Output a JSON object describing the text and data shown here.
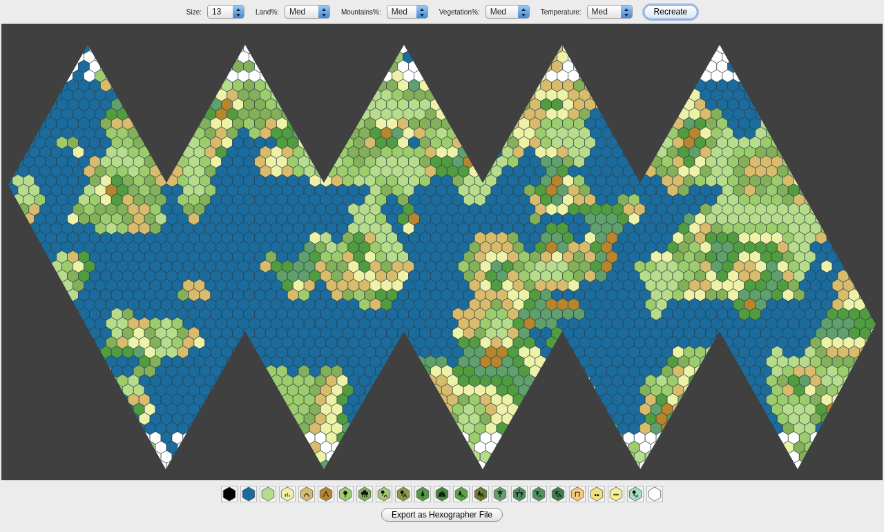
{
  "toolbar": {
    "fields": [
      {
        "label": "Size:",
        "value": "13"
      },
      {
        "label": "Land%:",
        "value": "Med"
      },
      {
        "label": "Mountains%:",
        "value": "Med"
      },
      {
        "label": "Vegetation%:",
        "value": "Med"
      },
      {
        "label": "Temperature:",
        "value": "Med"
      }
    ],
    "button": "Recreate"
  },
  "palette": [
    {
      "kind": "plain",
      "color": "#000000"
    },
    {
      "kind": "plain",
      "color": "#1b6c9c"
    },
    {
      "kind": "plain",
      "color": "#b6dc8c"
    },
    {
      "kind": "grass",
      "color": "#eef2a6"
    },
    {
      "kind": "hills",
      "color": "#d8bc6c"
    },
    {
      "kind": "mountain",
      "color": "#b6852c"
    },
    {
      "kind": "tree",
      "color": "#9ccc6c"
    },
    {
      "kind": "trees",
      "color": "#84b05a"
    },
    {
      "kind": "tree-hills",
      "color": "#a4c87a"
    },
    {
      "kind": "tree-mountain",
      "color": "#8e9848"
    },
    {
      "kind": "pine",
      "color": "#529c40"
    },
    {
      "kind": "pines",
      "color": "#428a3a"
    },
    {
      "kind": "pine-hills",
      "color": "#5ca444"
    },
    {
      "kind": "pine-mountain",
      "color": "#6c7a32"
    },
    {
      "kind": "palm",
      "color": "#60a06c"
    },
    {
      "kind": "palms",
      "color": "#4c8e5e"
    },
    {
      "kind": "palm-hills",
      "color": "#529262"
    },
    {
      "kind": "palm-mountain",
      "color": "#407e52"
    },
    {
      "kind": "arch",
      "color": "#f6c87a"
    },
    {
      "kind": "dots2",
      "color": "#f2e07c"
    },
    {
      "kind": "dots3",
      "color": "#f6ee94"
    },
    {
      "kind": "tree-grass",
      "color": "#a8dcc0"
    },
    {
      "kind": "plain",
      "color": "#ffffff"
    }
  ],
  "export_button": "Export as Hexographer File"
}
